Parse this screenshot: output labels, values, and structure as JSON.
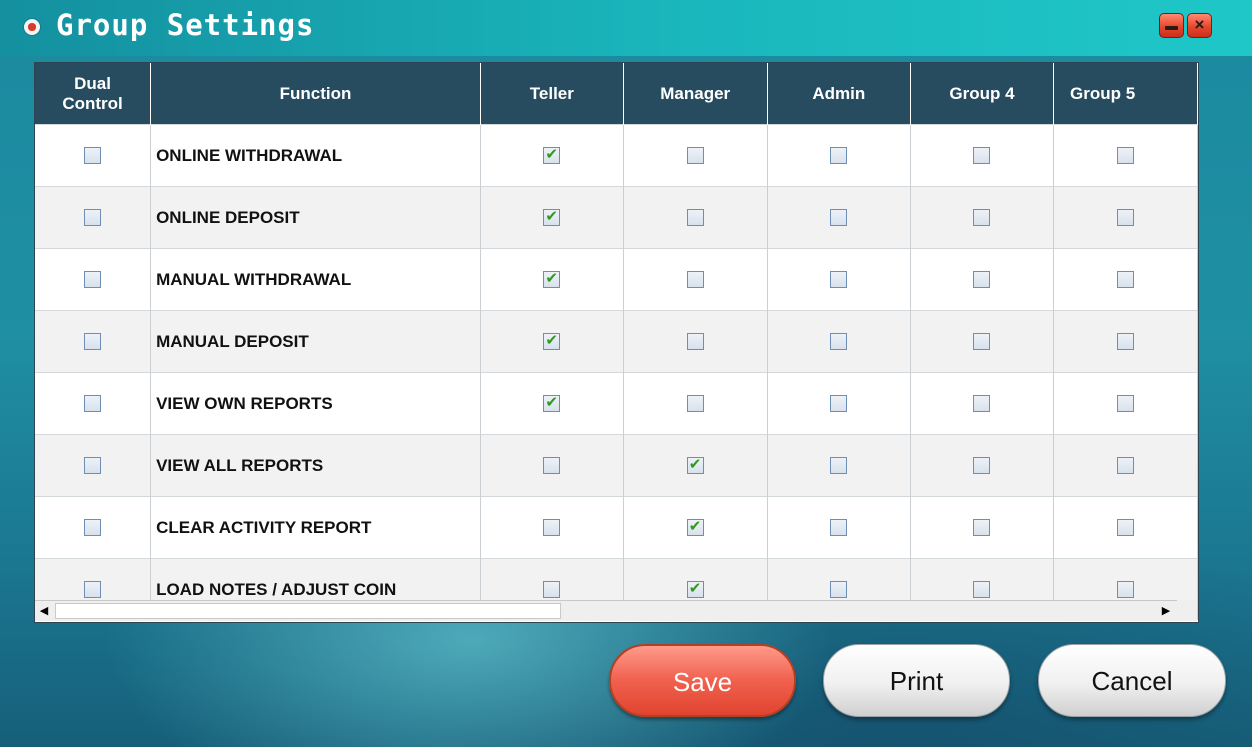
{
  "window": {
    "title": "Group Settings",
    "minimize_icon": "minimize-icon",
    "close_icon": "close-icon",
    "close_glyph": "×"
  },
  "table": {
    "headers": {
      "dual_control": "Dual Control",
      "function": "Function",
      "teller": "Teller",
      "manager": "Manager",
      "admin": "Admin",
      "group4": "Group 4",
      "group5": "Group 5"
    },
    "rows": [
      {
        "function": "ONLINE WITHDRAWAL",
        "dual_control": false,
        "teller": true,
        "manager": false,
        "admin": false,
        "group4": false,
        "group5": false
      },
      {
        "function": "ONLINE DEPOSIT",
        "dual_control": false,
        "teller": true,
        "manager": false,
        "admin": false,
        "group4": false,
        "group5": false
      },
      {
        "function": "MANUAL WITHDRAWAL",
        "dual_control": false,
        "teller": true,
        "manager": false,
        "admin": false,
        "group4": false,
        "group5": false
      },
      {
        "function": "MANUAL DEPOSIT",
        "dual_control": false,
        "teller": true,
        "manager": false,
        "admin": false,
        "group4": false,
        "group5": false
      },
      {
        "function": "VIEW OWN REPORTS",
        "dual_control": false,
        "teller": true,
        "manager": false,
        "admin": false,
        "group4": false,
        "group5": false
      },
      {
        "function": "VIEW ALL REPORTS",
        "dual_control": false,
        "teller": false,
        "manager": true,
        "admin": false,
        "group4": false,
        "group5": false
      },
      {
        "function": "CLEAR ACTIVITY REPORT",
        "dual_control": false,
        "teller": false,
        "manager": true,
        "admin": false,
        "group4": false,
        "group5": false
      },
      {
        "function": "LOAD NOTES / ADJUST COIN",
        "dual_control": false,
        "teller": false,
        "manager": true,
        "admin": false,
        "group4": false,
        "group5": false
      }
    ]
  },
  "scrollbars": {
    "up_glyph": "▲",
    "down_glyph": "▼",
    "left_glyph": "◀",
    "right_glyph": "▶"
  },
  "buttons": {
    "save": "Save",
    "print": "Print",
    "cancel": "Cancel"
  },
  "colors": {
    "title_bar": "#1ab7bd",
    "header_bg": "#274c5f",
    "save_accent": "#f0614e",
    "check_green": "#2f9a1b"
  }
}
